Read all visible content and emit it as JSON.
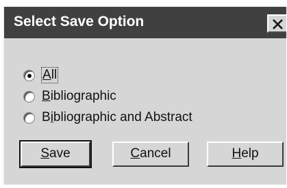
{
  "window": {
    "title": "Select Save Option",
    "close_glyph": "X"
  },
  "options": [
    {
      "label_prefix": "",
      "label_mnemonic": "A",
      "label_rest": "ll",
      "selected": true
    },
    {
      "label_prefix": "",
      "label_mnemonic": "B",
      "label_rest": "ibliographic",
      "selected": false
    },
    {
      "label_prefix": "B",
      "label_mnemonic": "i",
      "label_rest": "bliographic and Abstract",
      "selected": false
    }
  ],
  "buttons": {
    "save": {
      "mnemonic": "S",
      "rest": "ave"
    },
    "cancel": {
      "mnemonic": "C",
      "rest": "ancel"
    },
    "help": {
      "mnemonic": "H",
      "rest": "elp"
    }
  },
  "colors": {
    "titlebar": "#404040",
    "dialog_face": "#d6d6d6"
  }
}
